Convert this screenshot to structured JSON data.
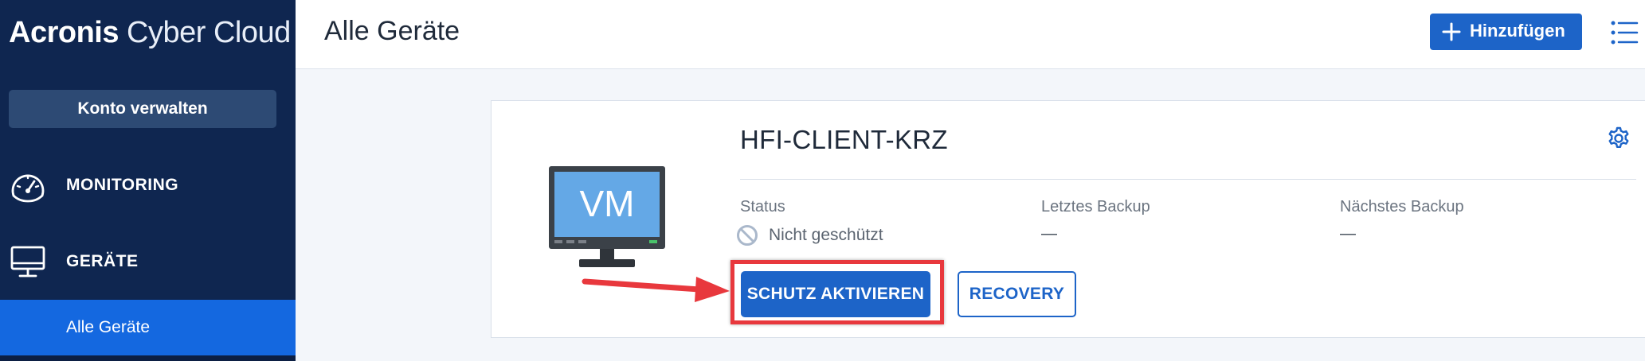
{
  "brand": {
    "part1": "Acronis",
    "part2": " Cyber Cloud"
  },
  "sidebar": {
    "account_button": "Konto verwalten",
    "items": [
      {
        "label": "MONITORING",
        "icon": "speedometer-icon"
      },
      {
        "label": "GERÄTE",
        "icon": "monitor-icon"
      }
    ],
    "sub_items": [
      {
        "label": "Alle Geräte",
        "active": true
      }
    ]
  },
  "header": {
    "title": "Alle Geräte",
    "add_button": "Hinzufügen",
    "list_icon": "list-view-icon"
  },
  "device": {
    "name": "HFI-CLIENT-KRZ",
    "icon_text": "VM",
    "status_label": "Status",
    "status_value": "Nicht geschützt",
    "last_backup_label": "Letztes Backup",
    "last_backup_value": "—",
    "next_backup_label": "Nächstes Backup",
    "next_backup_value": "—",
    "protect_button": "SCHUTZ AKTIVIEREN",
    "recovery_button": "RECOVERY"
  },
  "colors": {
    "sidebar_bg": "#0f2650",
    "active_item": "#1468e0",
    "primary": "#1d64c8",
    "annotation": "#e8383d"
  }
}
